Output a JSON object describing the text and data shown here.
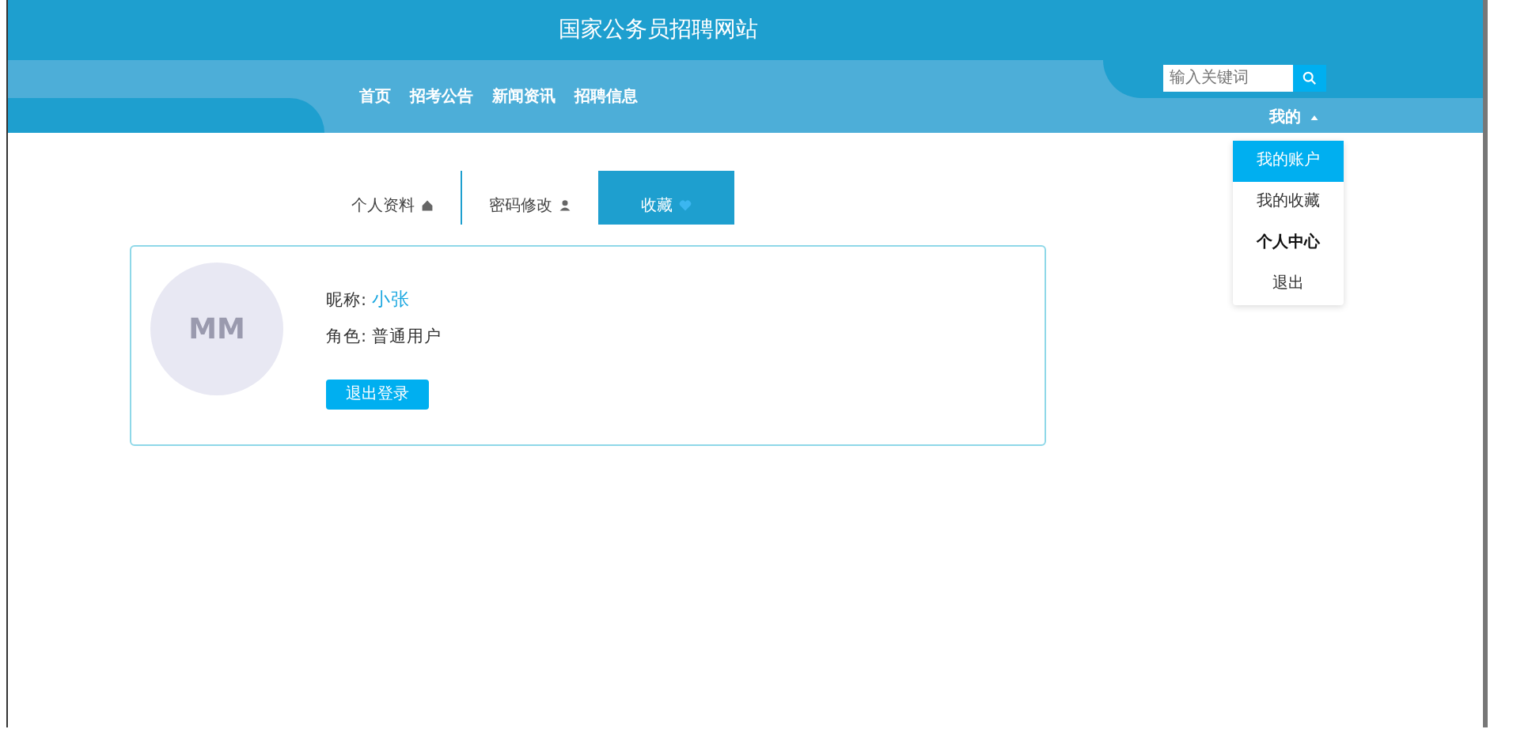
{
  "site_title": "国家公务员招聘网站",
  "nav": [
    "首页",
    "招考公告",
    "新闻资讯",
    "招聘信息"
  ],
  "search": {
    "placeholder": "输入关键词"
  },
  "user_menu": {
    "label": "我的",
    "expanded": true,
    "items": [
      {
        "label": "我的账户",
        "selected": true
      },
      {
        "label": "我的收藏",
        "selected": false
      },
      {
        "label": "个人中心",
        "selected": false
      },
      {
        "label": "退出",
        "selected": false
      }
    ]
  },
  "tabs": [
    {
      "label": "个人资料",
      "selected": false
    },
    {
      "label": "密码修改",
      "selected": false
    },
    {
      "label": "收藏",
      "selected": true
    }
  ],
  "profile": {
    "avatar": "MM",
    "nickname_label": "昵称:",
    "nickname": "小张",
    "role_label": "角色:",
    "role": "普通用户",
    "logout_button": "退出登录"
  }
}
